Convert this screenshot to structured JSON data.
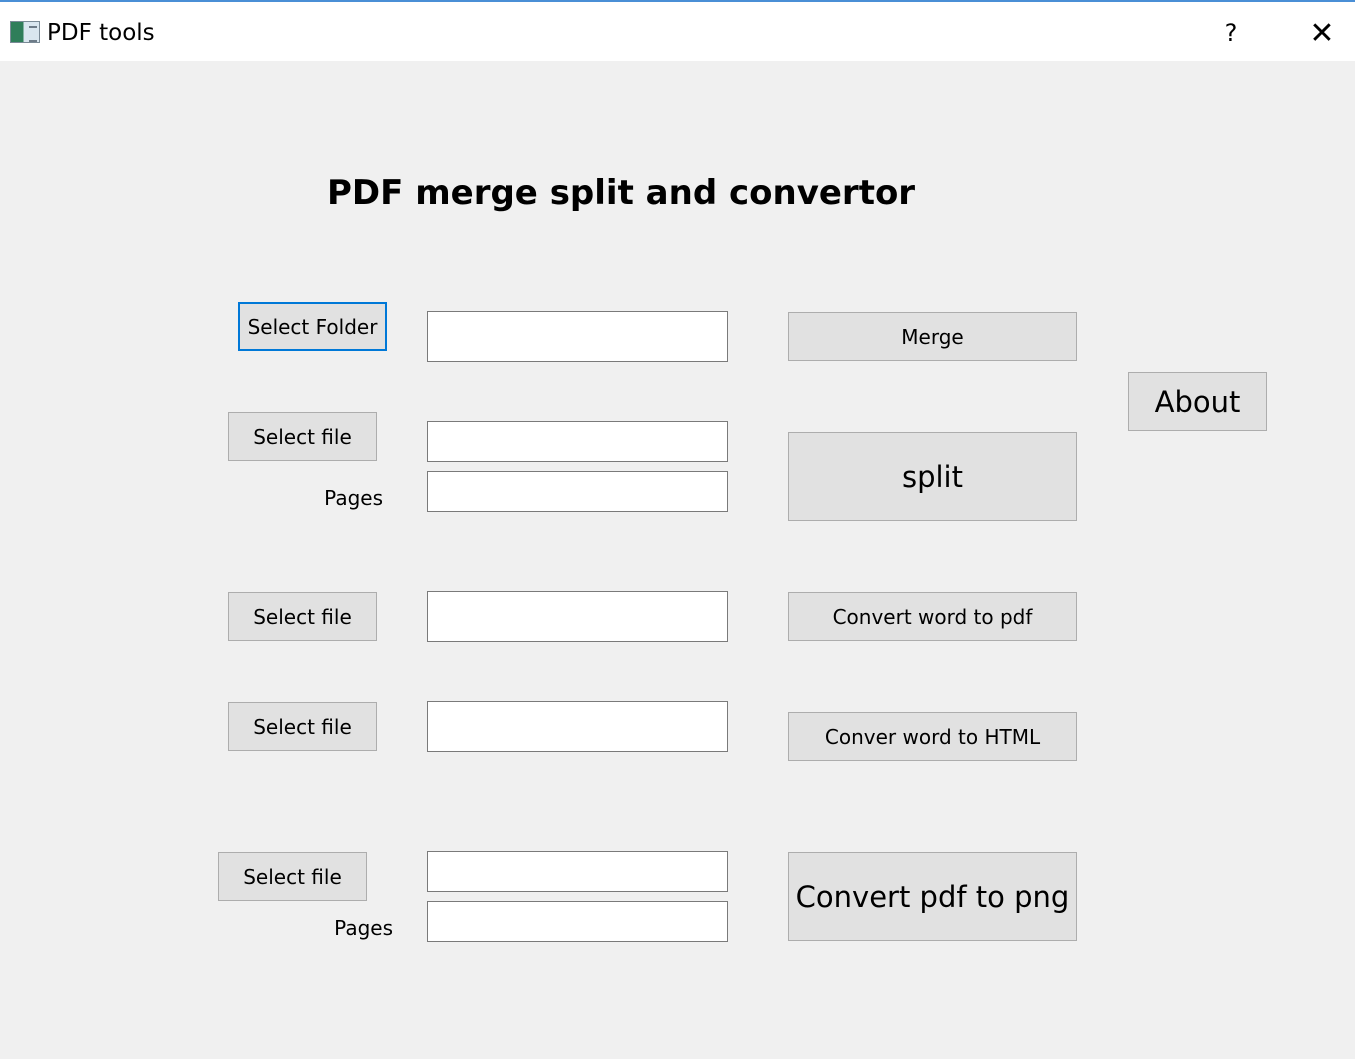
{
  "window": {
    "title": "PDF tools",
    "help_label": "?",
    "close_label": "✕"
  },
  "heading": "PDF merge split and convertor",
  "merge_section": {
    "select_label": "Select Folder",
    "path_value": "",
    "action_label": "Merge"
  },
  "split_section": {
    "select_label": "Select file",
    "file_value": "",
    "pages_label": "Pages",
    "pages_value": "",
    "action_label": "split"
  },
  "word_to_pdf_section": {
    "select_label": "Select file",
    "file_value": "",
    "action_label": "Convert word to pdf"
  },
  "word_to_html_section": {
    "select_label": "Select file",
    "file_value": "",
    "action_label": "Conver word to HTML"
  },
  "pdf_to_png_section": {
    "select_label": "Select file",
    "file_value": "",
    "pages_label": "Pages",
    "pages_value": "",
    "action_label": "Convert pdf to png"
  },
  "about_label": "About",
  "colors": {
    "window_bg": "#f0f0f0",
    "button_bg": "#e1e1e1",
    "focus_border": "#0078d7"
  }
}
